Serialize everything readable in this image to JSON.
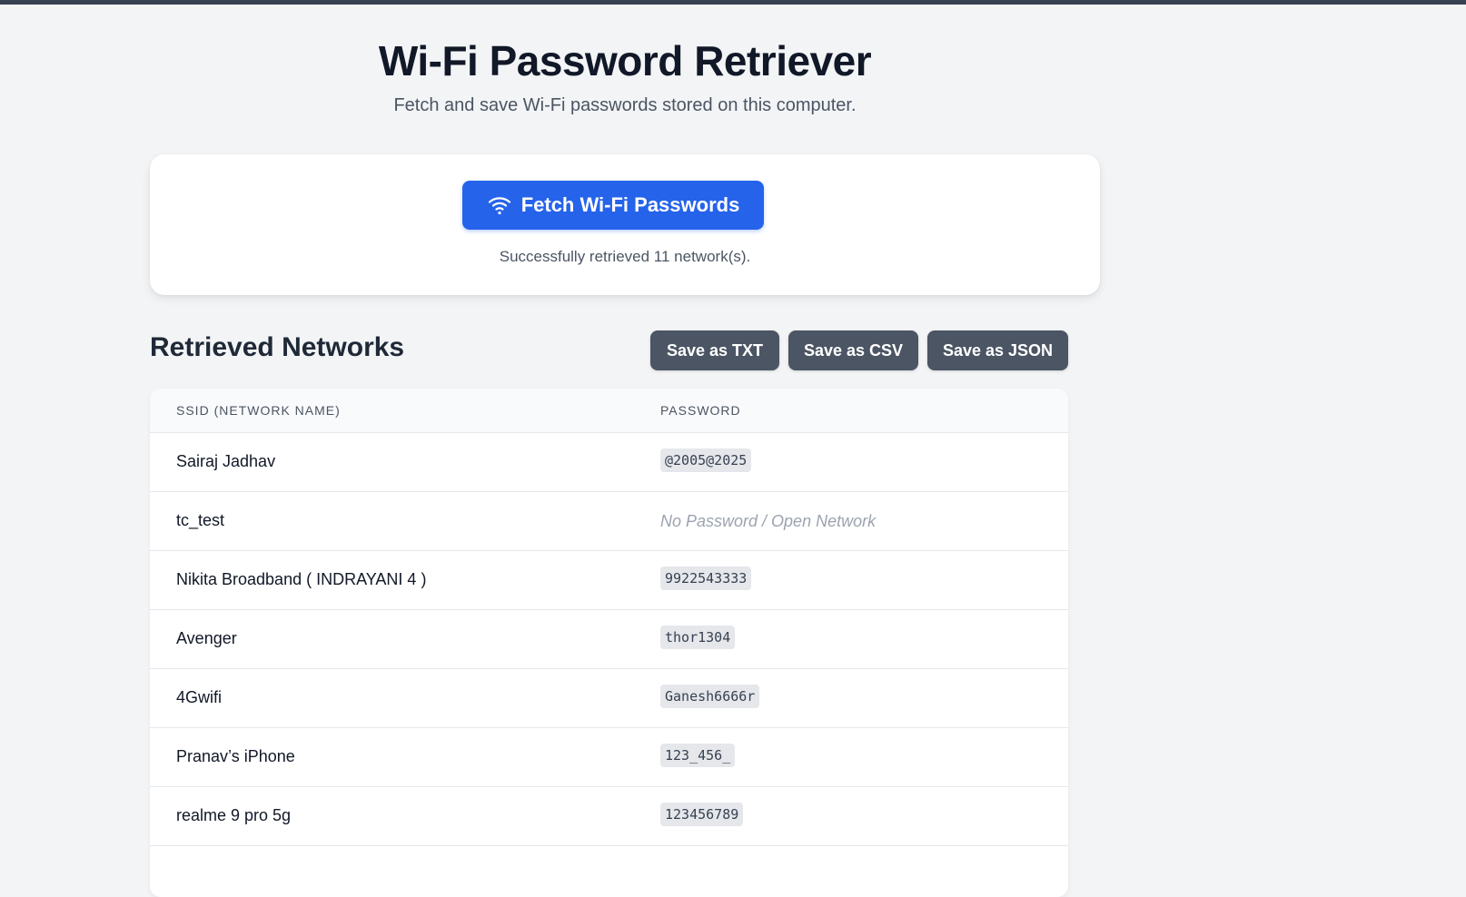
{
  "header": {
    "title": "Wi-Fi Password Retriever",
    "subtitle": "Fetch and save Wi-Fi passwords stored on this computer."
  },
  "fetch_panel": {
    "button_label": "Fetch Wi-Fi Passwords",
    "button_icon": "wifi-icon",
    "status": "Successfully retrieved 11 network(s)."
  },
  "results": {
    "title": "Retrieved Networks",
    "save_txt": "Save as TXT",
    "save_csv": "Save as CSV",
    "save_json": "Save as JSON",
    "columns": [
      "SSID (NETWORK NAME)",
      "PASSWORD"
    ],
    "rows": [
      {
        "ssid": "Sairaj Jadhav",
        "password": "@2005@2025",
        "open": false
      },
      {
        "ssid": "tc_test",
        "password": "No Password / Open Network",
        "open": true
      },
      {
        "ssid": "Nikita Broadband ( INDRAYANI 4 )",
        "password": "9922543333",
        "open": false
      },
      {
        "ssid": "Avenger",
        "password": "thor1304",
        "open": false
      },
      {
        "ssid": "4Gwifi",
        "password": "Ganesh6666r",
        "open": false
      },
      {
        "ssid": "Pranav’s iPhone",
        "password": "123_456_",
        "open": false
      },
      {
        "ssid": "realme 9 pro 5g",
        "password": "123456789",
        "open": false
      }
    ]
  },
  "colors": {
    "primary": "#2563eb",
    "secondary_button": "#4b5563",
    "background": "#f3f4f6"
  }
}
